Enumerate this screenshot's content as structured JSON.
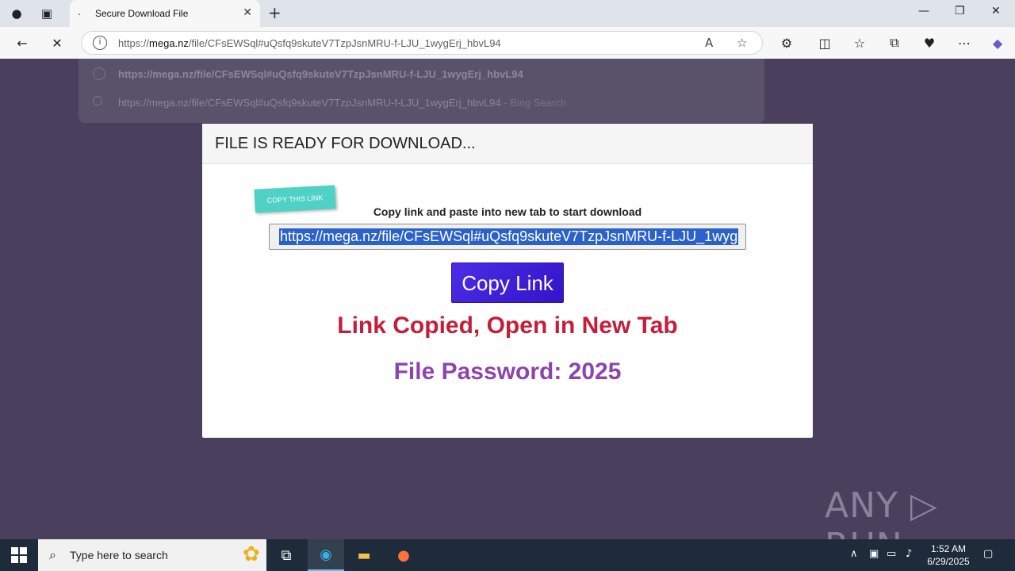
{
  "browser": {
    "tab_title": "Secure Download File",
    "tab_favicon": ".",
    "address_url_prefix": "https://",
    "address_url_domain": "mega.nz",
    "address_url_path": "/file/CFsEWSql#uQsfq9skuteV7TzpJsnMRU-f-LJU_1wygErj_hbvL94"
  },
  "suggestions": {
    "item1": "https://mega.nz/file/CFsEWSql#uQsfq9skuteV7TzpJsnMRU-f-LJU_1wygErj_hbvL94",
    "item2": "https://mega.nz/file/CFsEWSql#uQsfq9skuteV7TzpJsnMRU-f-LJU_1wygErj_hbvL94",
    "item2_suffix": " - Bing Search"
  },
  "modal": {
    "title": "FILE IS READY FOR DOWNLOAD...",
    "sticker": "COPY THIS LINK",
    "instruction": "Copy link and paste into new tab to start download",
    "link_value": "https://mega.nz/file/CFsEWSql#uQsfq9skuteV7TzpJsnMRU-f-LJU_1wyg",
    "copy_button": "Copy Link",
    "copied_message": "Link Copied, Open in New Tab",
    "password_text": "File Password: 2025"
  },
  "watermark": "ANY ▷ RUN",
  "taskbar": {
    "search_placeholder": "Type here to search",
    "time": "1:52 AM",
    "date": "6/29/2025"
  },
  "colors": {
    "copy_button": "#3b1fd9",
    "copied_message": "#c41e3a",
    "password": "#8e44ad",
    "sticker": "#4fd1c5"
  }
}
